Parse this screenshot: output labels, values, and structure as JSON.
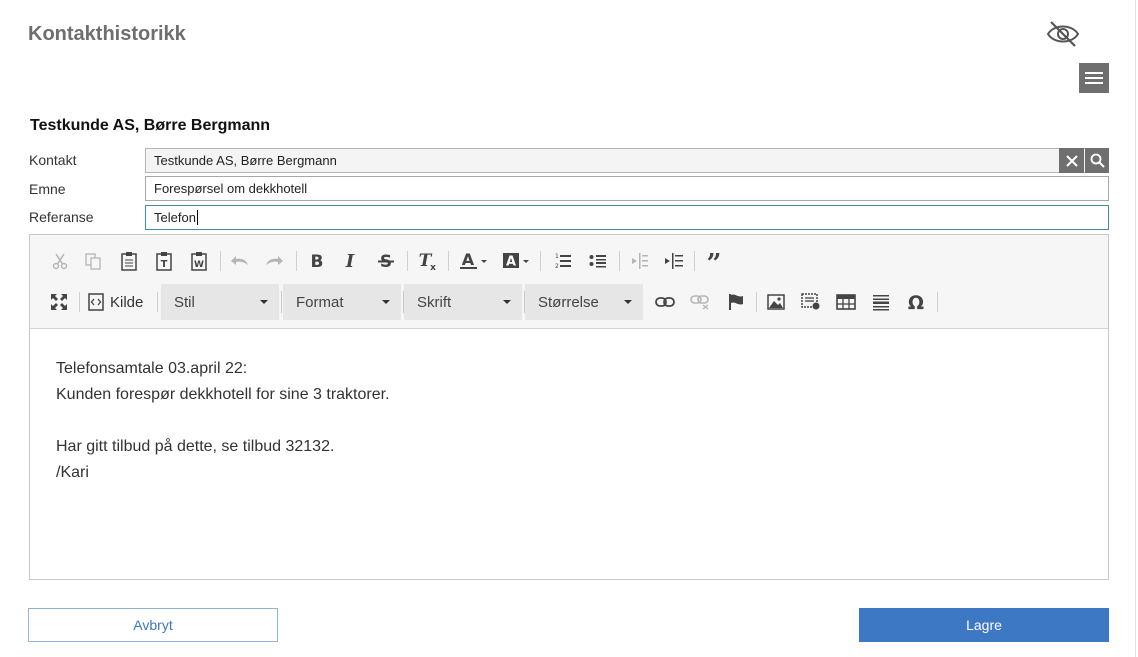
{
  "header": {
    "title": "Kontakthistorikk"
  },
  "icons": {
    "hide": "eye-off-icon",
    "menu": "hamburger-menu-icon"
  },
  "customer": {
    "name": "Testkunde AS, Børre Bergmann"
  },
  "form": {
    "contact": {
      "label": "Kontakt",
      "value": "Testkunde AS, Børre Bergmann"
    },
    "subject": {
      "label": "Emne",
      "value": "Forespørsel om dekkhotell"
    },
    "reference": {
      "label": "Referanse",
      "value": "Telefon"
    }
  },
  "editor": {
    "toolbar": {
      "source_label": "Kilde",
      "combos": {
        "style": "Stil",
        "format": "Format",
        "font": "Skrift",
        "size": "Størrelse"
      }
    },
    "content": {
      "lines": [
        "Telefonsamtale 03.april 22:",
        "Kunden forespør dekkhotell for sine 3 traktorer.",
        "",
        "Har gitt tilbud på dette, se tilbud 32132.",
        "/Kari"
      ]
    }
  },
  "actions": {
    "cancel_label": "Avbryt",
    "save_label": "Lagre"
  },
  "colors": {
    "primary": "#3d78c4",
    "title_gray": "#6e6e6e",
    "icon_dark": "#444444",
    "icon_disabled": "#b5b5b5"
  }
}
